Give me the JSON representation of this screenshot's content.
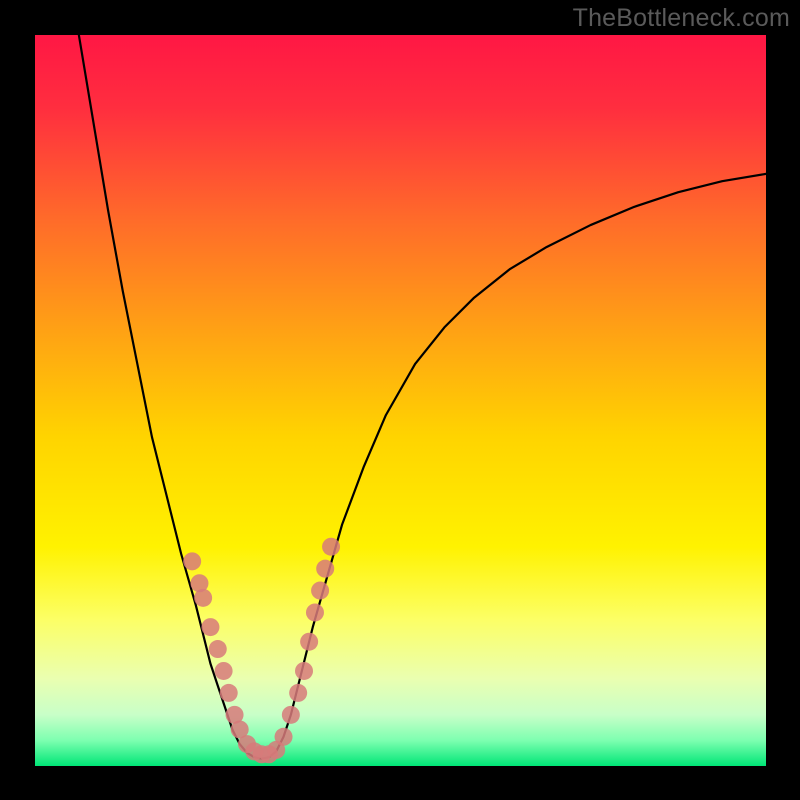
{
  "watermark": "TheBottleneck.com",
  "chart_data": {
    "type": "line",
    "title": "",
    "xlabel": "",
    "ylabel": "",
    "xlim": [
      0,
      100
    ],
    "ylim": [
      0,
      100
    ],
    "gradient_stops": [
      {
        "offset": 0.0,
        "color": "#ff1744"
      },
      {
        "offset": 0.1,
        "color": "#ff2e3f"
      },
      {
        "offset": 0.25,
        "color": "#ff6a2a"
      },
      {
        "offset": 0.4,
        "color": "#ffa015"
      },
      {
        "offset": 0.55,
        "color": "#ffd400"
      },
      {
        "offset": 0.7,
        "color": "#fff200"
      },
      {
        "offset": 0.8,
        "color": "#fcff66"
      },
      {
        "offset": 0.88,
        "color": "#eaffb0"
      },
      {
        "offset": 0.93,
        "color": "#c8ffc8"
      },
      {
        "offset": 0.965,
        "color": "#7dffb0"
      },
      {
        "offset": 1.0,
        "color": "#00e676"
      }
    ],
    "curve": [
      {
        "x": 6,
        "y": 100
      },
      {
        "x": 8,
        "y": 88
      },
      {
        "x": 10,
        "y": 76
      },
      {
        "x": 12,
        "y": 65
      },
      {
        "x": 14,
        "y": 55
      },
      {
        "x": 16,
        "y": 45
      },
      {
        "x": 18,
        "y": 37
      },
      {
        "x": 20,
        "y": 29
      },
      {
        "x": 22,
        "y": 22
      },
      {
        "x": 23,
        "y": 18
      },
      {
        "x": 24,
        "y": 14
      },
      {
        "x": 25,
        "y": 11
      },
      {
        "x": 26,
        "y": 8
      },
      {
        "x": 27,
        "y": 5
      },
      {
        "x": 28,
        "y": 3
      },
      {
        "x": 29,
        "y": 1.8
      },
      {
        "x": 30,
        "y": 1.2
      },
      {
        "x": 31,
        "y": 1
      },
      {
        "x": 32,
        "y": 1.2
      },
      {
        "x": 33,
        "y": 2
      },
      {
        "x": 34,
        "y": 4
      },
      {
        "x": 35,
        "y": 7
      },
      {
        "x": 36,
        "y": 11
      },
      {
        "x": 37,
        "y": 15
      },
      {
        "x": 38,
        "y": 19
      },
      {
        "x": 40,
        "y": 26
      },
      {
        "x": 42,
        "y": 33
      },
      {
        "x": 45,
        "y": 41
      },
      {
        "x": 48,
        "y": 48
      },
      {
        "x": 52,
        "y": 55
      },
      {
        "x": 56,
        "y": 60
      },
      {
        "x": 60,
        "y": 64
      },
      {
        "x": 65,
        "y": 68
      },
      {
        "x": 70,
        "y": 71
      },
      {
        "x": 76,
        "y": 74
      },
      {
        "x": 82,
        "y": 76.5
      },
      {
        "x": 88,
        "y": 78.5
      },
      {
        "x": 94,
        "y": 80
      },
      {
        "x": 100,
        "y": 81
      }
    ],
    "markers": [
      {
        "x": 21.5,
        "y": 28
      },
      {
        "x": 22.5,
        "y": 25
      },
      {
        "x": 23,
        "y": 23
      },
      {
        "x": 24,
        "y": 19
      },
      {
        "x": 25,
        "y": 16
      },
      {
        "x": 25.8,
        "y": 13
      },
      {
        "x": 26.5,
        "y": 10
      },
      {
        "x": 27.3,
        "y": 7
      },
      {
        "x": 28,
        "y": 5
      },
      {
        "x": 29,
        "y": 3
      },
      {
        "x": 30,
        "y": 2
      },
      {
        "x": 31,
        "y": 1.6
      },
      {
        "x": 32,
        "y": 1.6
      },
      {
        "x": 33,
        "y": 2.2
      },
      {
        "x": 34,
        "y": 4
      },
      {
        "x": 35,
        "y": 7
      },
      {
        "x": 36,
        "y": 10
      },
      {
        "x": 36.8,
        "y": 13
      },
      {
        "x": 37.5,
        "y": 17
      },
      {
        "x": 38.3,
        "y": 21
      },
      {
        "x": 39,
        "y": 24
      },
      {
        "x": 39.7,
        "y": 27
      },
      {
        "x": 40.5,
        "y": 30
      }
    ],
    "marker_style": {
      "radius": 9,
      "fill": "#d77a7a",
      "opacity": 0.85
    },
    "curve_style": {
      "stroke": "#000000",
      "width": 2.2
    }
  }
}
